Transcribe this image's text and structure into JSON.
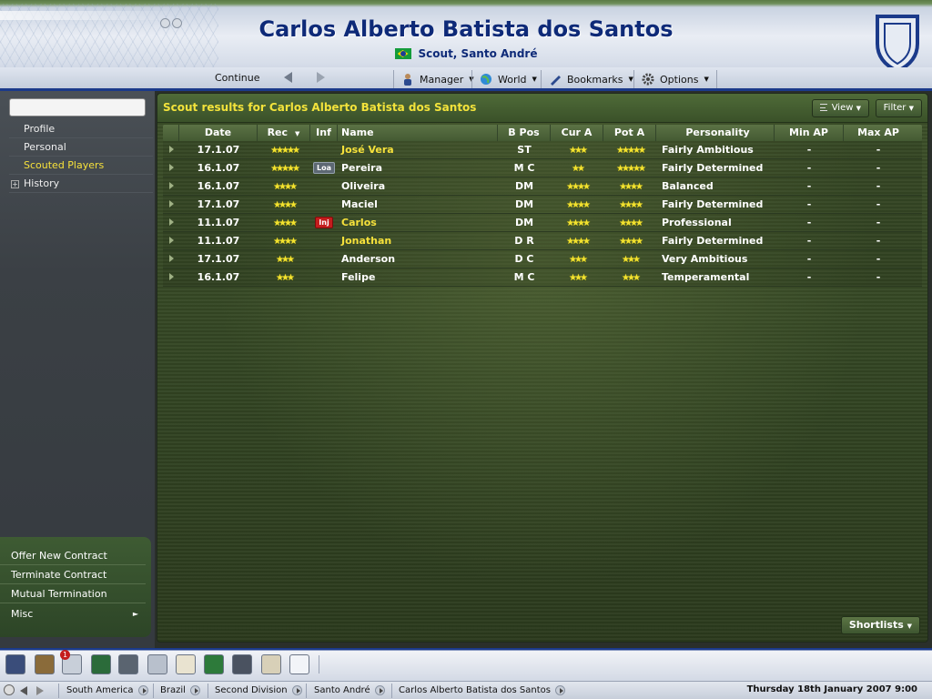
{
  "header": {
    "title": "Carlos Alberto Batista dos Santos",
    "subtitle": "Scout, Santo André",
    "continue_label": "Continue",
    "menus": {
      "manager": "Manager",
      "world": "World",
      "bookmarks": "Bookmarks",
      "options": "Options"
    }
  },
  "sidebar": {
    "search_value": "",
    "items": [
      {
        "label": "Profile"
      },
      {
        "label": "Personal"
      },
      {
        "label": "Scouted Players"
      },
      {
        "label": "History"
      }
    ],
    "actions": [
      {
        "label": "Offer New Contract"
      },
      {
        "label": "Terminate Contract"
      },
      {
        "label": "Mutual Termination"
      },
      {
        "label": "Misc"
      }
    ]
  },
  "panel": {
    "title": "Scout results for Carlos Alberto Batista dos Santos",
    "view_label": "View",
    "filter_label": "Filter",
    "shortlists_label": "Shortlists"
  },
  "table": {
    "headers": {
      "date": "Date",
      "rec": "Rec",
      "inf": "Inf",
      "name": "Name",
      "bpos": "B Pos",
      "cura": "Cur A",
      "pota": "Pot A",
      "personality": "Personality",
      "minap": "Min AP",
      "maxap": "Max AP"
    },
    "rows": [
      {
        "date": "17.1.07",
        "rec": 5,
        "inf": "",
        "name": "José Vera",
        "bpos": "ST",
        "cura": 3,
        "pota": 5,
        "personality": "Fairly Ambitious",
        "minap": "-",
        "maxap": "-"
      },
      {
        "date": "16.1.07",
        "rec": 5,
        "inf": "Loa",
        "name": "Pereira",
        "bpos": "M C",
        "cura": 2,
        "pota": 5,
        "personality": "Fairly Determined",
        "minap": "-",
        "maxap": "-"
      },
      {
        "date": "16.1.07",
        "rec": 4,
        "inf": "",
        "name": "Oliveira",
        "bpos": "DM",
        "cura": 4,
        "pota": 4,
        "personality": "Balanced",
        "minap": "-",
        "maxap": "-"
      },
      {
        "date": "17.1.07",
        "rec": 4,
        "inf": "",
        "name": "Maciel",
        "bpos": "DM",
        "cura": 4,
        "pota": 4,
        "personality": "Fairly Determined",
        "minap": "-",
        "maxap": "-"
      },
      {
        "date": "11.1.07",
        "rec": 4,
        "inf": "Inj",
        "name": "Carlos",
        "bpos": "DM",
        "cura": 4,
        "pota": 4,
        "personality": "Professional",
        "minap": "-",
        "maxap": "-"
      },
      {
        "date": "11.1.07",
        "rec": 4,
        "inf": "",
        "name": "Jonathan",
        "bpos": "D R",
        "cura": 4,
        "pota": 4,
        "personality": "Fairly Determined",
        "minap": "-",
        "maxap": "-"
      },
      {
        "date": "17.1.07",
        "rec": 3,
        "inf": "",
        "name": "Anderson",
        "bpos": "D C",
        "cura": 3,
        "pota": 3,
        "personality": "Very Ambitious",
        "minap": "-",
        "maxap": "-"
      },
      {
        "date": "16.1.07",
        "rec": 3,
        "inf": "",
        "name": "Felipe",
        "bpos": "M C",
        "cura": 3,
        "pota": 3,
        "personality": "Temperamental",
        "minap": "-",
        "maxap": "-"
      }
    ]
  },
  "iconbar": {
    "inbox_count": "1",
    "icons": [
      "home-icon",
      "book-icon",
      "stopwatch-icon",
      "tactics-icon",
      "computer-icon",
      "trophy-icon",
      "clipboard-icon",
      "pitch-board-icon",
      "binoculars-icon",
      "notepad-icon",
      "speech-bubble-icon"
    ]
  },
  "statusbar": {
    "crumbs": [
      "South America",
      "Brazil",
      "Second Division",
      "Santo André",
      "Carlos Alberto Batista dos Santos"
    ],
    "datetime": "Thursday 18th January 2007 9:00"
  },
  "colors": {
    "title_blue": "#0e2a78",
    "highlight_yellow": "#f6e13b",
    "injury_red": "#c41d1d"
  }
}
